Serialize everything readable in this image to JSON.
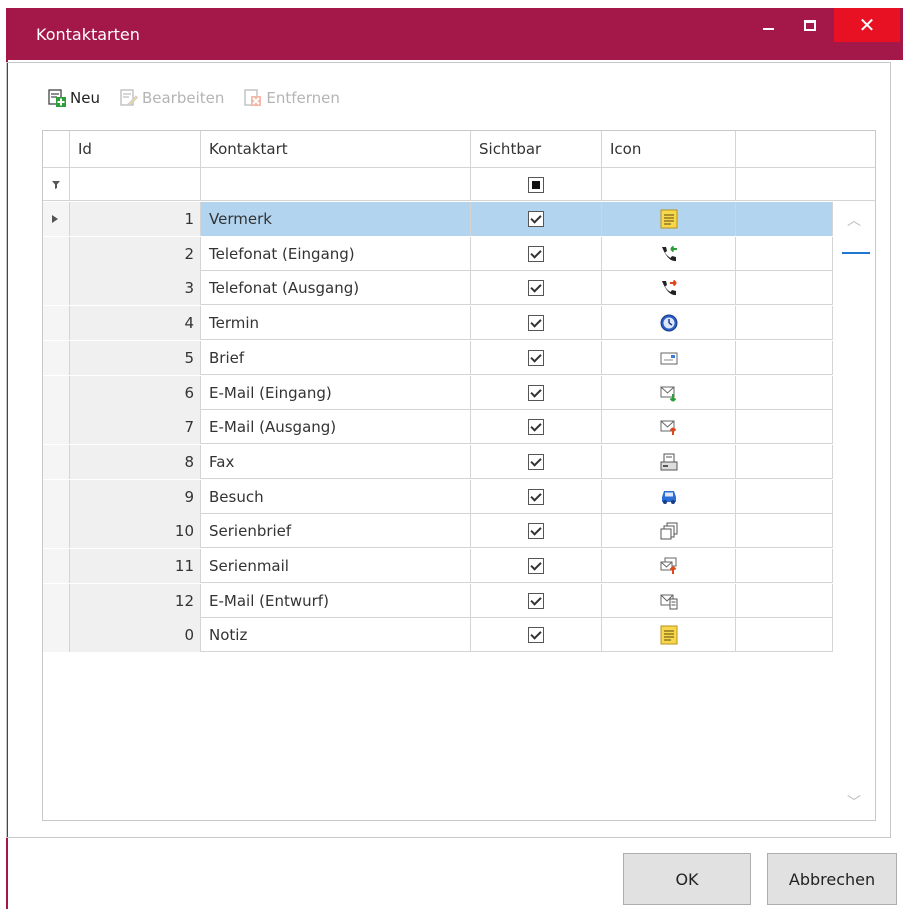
{
  "window": {
    "title": "Kontaktarten"
  },
  "toolbar": {
    "new_label": "Neu",
    "edit_label": "Bearbeiten",
    "remove_label": "Entfernen"
  },
  "grid": {
    "columns": [
      "Id",
      "Kontaktart",
      "Sichtbar",
      "Icon"
    ],
    "filter_sichtbar": "indeterminate",
    "rows": [
      {
        "id": "1",
        "name": "Vermerk",
        "visible": true,
        "icon": "note-icon",
        "selected": true
      },
      {
        "id": "2",
        "name": "Telefonat (Eingang)",
        "visible": true,
        "icon": "phone-incoming-icon"
      },
      {
        "id": "3",
        "name": "Telefonat (Ausgang)",
        "visible": true,
        "icon": "phone-outgoing-icon"
      },
      {
        "id": "4",
        "name": "Termin",
        "visible": true,
        "icon": "clock-icon"
      },
      {
        "id": "5",
        "name": "Brief",
        "visible": true,
        "icon": "letter-icon"
      },
      {
        "id": "6",
        "name": "E-Mail (Eingang)",
        "visible": true,
        "icon": "mail-incoming-icon"
      },
      {
        "id": "7",
        "name": "E-Mail (Ausgang)",
        "visible": true,
        "icon": "mail-outgoing-icon"
      },
      {
        "id": "8",
        "name": "Fax",
        "visible": true,
        "icon": "fax-icon"
      },
      {
        "id": "9",
        "name": "Besuch",
        "visible": true,
        "icon": "car-icon"
      },
      {
        "id": "10",
        "name": "Serienbrief",
        "visible": true,
        "icon": "serial-letter-icon"
      },
      {
        "id": "11",
        "name": "Serienmail",
        "visible": true,
        "icon": "serial-mail-icon"
      },
      {
        "id": "12",
        "name": "E-Mail (Entwurf)",
        "visible": true,
        "icon": "mail-draft-icon"
      },
      {
        "id": "0",
        "name": "Notiz",
        "visible": true,
        "icon": "note-icon"
      }
    ]
  },
  "buttons": {
    "ok_label": "OK",
    "cancel_label": "Abbrechen"
  },
  "colors": {
    "titlebar": "#a31848",
    "close": "#e81123",
    "selection": "#b2d4ef",
    "accent": "#1e78d2"
  }
}
